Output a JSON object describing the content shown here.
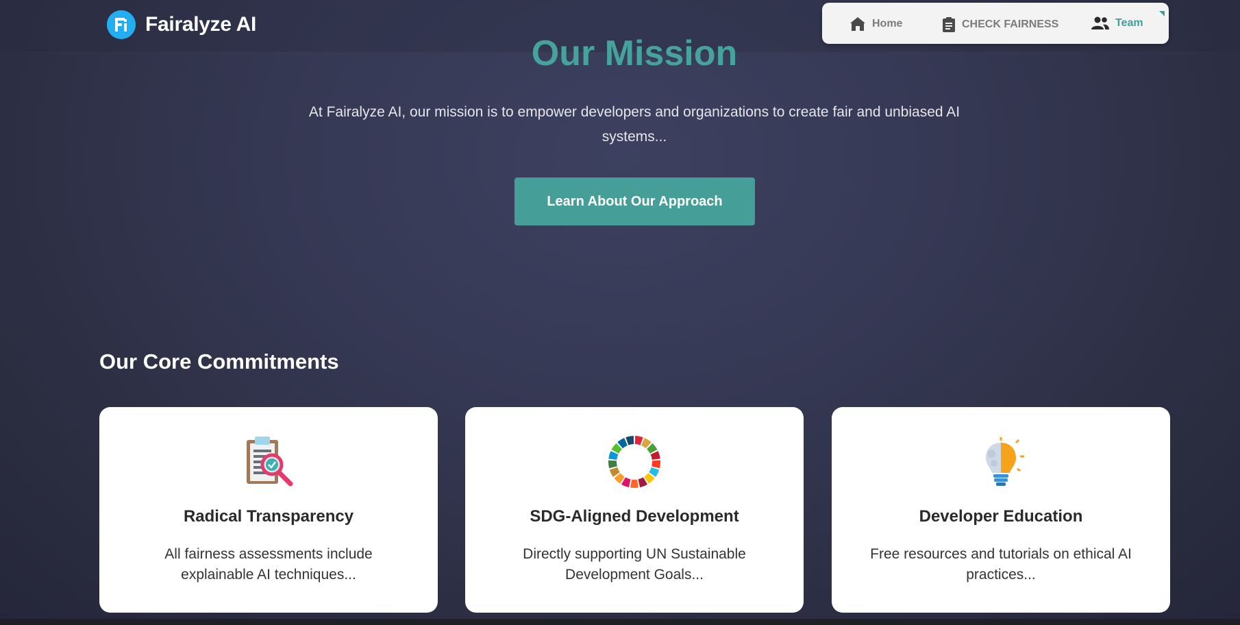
{
  "header": {
    "brand_name": "Fairalyze AI",
    "nav": [
      {
        "label": "Home",
        "icon": "home-icon"
      },
      {
        "label": "CHECK FAIRNESS",
        "icon": "clipboard-icon"
      },
      {
        "label": "Team",
        "icon": "team-icon",
        "active": true
      }
    ]
  },
  "hero": {
    "title": "Our Mission",
    "text": "At Fairalyze AI, our mission is to empower developers and organizations to create fair and unbiased AI systems...",
    "cta_label": "Learn About Our Approach"
  },
  "commitments": {
    "title": "Our Core Commitments",
    "cards": [
      {
        "title": "Radical Transparency",
        "text": "All fairness assessments include explainable AI techniques...",
        "icon": "clipboard-magnifier-icon"
      },
      {
        "title": "SDG-Aligned Development",
        "text": "Directly supporting UN Sustainable Development Goals...",
        "icon": "sdg-wheel-icon"
      },
      {
        "title": "Developer Education",
        "text": "Free resources and tutorials on ethical AI practices...",
        "icon": "lightbulb-brain-icon"
      }
    ]
  },
  "colors": {
    "accent": "#459f98",
    "title_teal": "#45a39c",
    "background": "#353853",
    "logo_blue": "#22aef0"
  }
}
